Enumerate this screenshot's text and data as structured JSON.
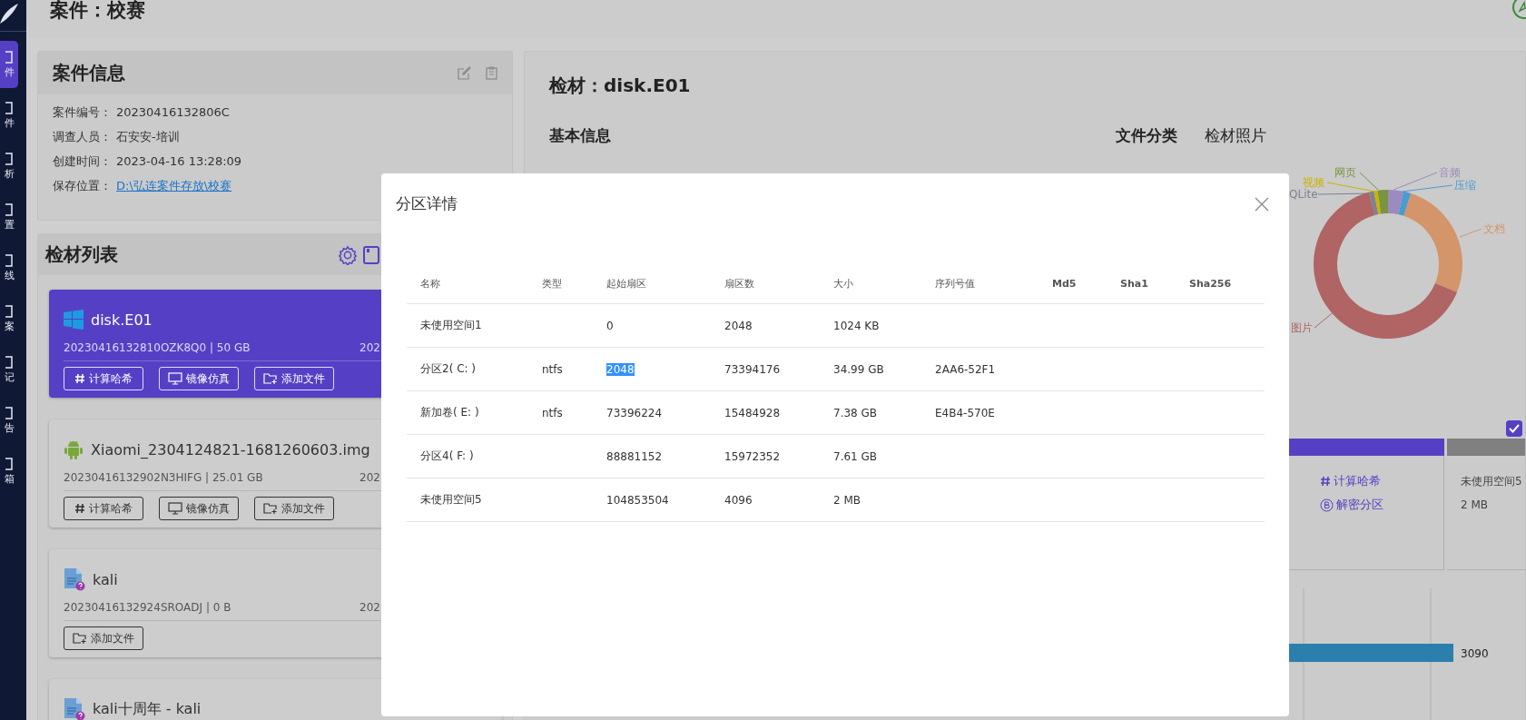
{
  "sidebar": {
    "items": [
      {
        "label": "件",
        "selected": true
      },
      {
        "label": "件",
        "selected": false
      },
      {
        "label": "析",
        "selected": false
      },
      {
        "label": "置",
        "selected": false
      },
      {
        "label": "线",
        "selected": false
      },
      {
        "label": "案",
        "selected": false
      },
      {
        "label": "记",
        "selected": false
      },
      {
        "label": "告",
        "selected": false
      },
      {
        "label": "箱",
        "selected": false
      }
    ]
  },
  "header": {
    "title": "案件：校赛"
  },
  "case_info": {
    "title": "案件信息",
    "fields": [
      {
        "label": "案件编号：",
        "value": "20230416132806C",
        "kind": "text"
      },
      {
        "label": "调查人员：",
        "value": "石安安-培训",
        "kind": "text"
      },
      {
        "label": "创建时间：",
        "value": "2023-04-16 13:28:09",
        "kind": "text"
      },
      {
        "label": "保存位置：",
        "value": "D:\\弘连案件存放\\校赛",
        "kind": "link"
      }
    ]
  },
  "evidence_list": {
    "title": "检材列表",
    "items": [
      {
        "name": "disk.E01",
        "kind": "windows",
        "selected": true,
        "meta": "20230416132810OZK8Q0 | 50 GB",
        "date": "202",
        "actions": [
          {
            "label": "计算哈希",
            "kind": "hash"
          },
          {
            "label": "镜像仿真",
            "kind": "emulate"
          },
          {
            "label": "添加文件",
            "kind": "add"
          }
        ]
      },
      {
        "name": "Xiaomi_2304124821-1681260603.img",
        "kind": "android",
        "selected": false,
        "meta": "20230416132902N3HIFG | 25.01 GB",
        "date": "202",
        "actions": [
          {
            "label": "计算哈希",
            "kind": "hash"
          },
          {
            "label": "镜像仿真",
            "kind": "emulate"
          },
          {
            "label": "添加文件",
            "kind": "add"
          }
        ]
      },
      {
        "name": "kali",
        "kind": "document",
        "selected": false,
        "meta": "20230416132924SROADJ | 0 B",
        "date": "202",
        "actions": [
          {
            "label": "添加文件",
            "kind": "add"
          }
        ]
      },
      {
        "name": "kali十周年 - kali",
        "kind": "document",
        "selected": false
      }
    ]
  },
  "evidence": {
    "title": "检材：disk.E01",
    "basic_info_title": "基本信息",
    "tabs": [
      {
        "label": "文件分类",
        "selected": true
      },
      {
        "label": "检材照片",
        "selected": false
      }
    ],
    "file_categories": [
      {
        "label": "QLite",
        "color": "#7b8294"
      },
      {
        "label": "视频",
        "color": "#c8b400"
      },
      {
        "label": "网页",
        "color": "#7a9440"
      },
      {
        "label": "音频",
        "color": "#9b8bbf"
      },
      {
        "label": "压缩",
        "color": "#4a9bd0"
      },
      {
        "label": "文档",
        "color": "#d4956a"
      },
      {
        "label": "图片",
        "color": "#b06464"
      }
    ],
    "show_partitions": {
      "checked": true
    },
    "partitions": [
      {
        "selected": true,
        "actions": [
          {
            "label": "计算哈希",
            "kind": "hash"
          },
          {
            "label": "解密分区",
            "kind": "decrypt"
          }
        ]
      },
      {
        "selected": false,
        "name": "未使用空间5",
        "size": "2 MB"
      }
    ],
    "bar_chart": {
      "value_label": "3090"
    }
  },
  "dialog": {
    "title": "分区详情",
    "columns": [
      "名称",
      "类型",
      "起始扇区",
      "扇区数",
      "大小",
      "序列号值",
      "Md5",
      "Sha1",
      "Sha256"
    ],
    "rows": [
      {
        "name": "未使用空间1",
        "start_sector": "0",
        "start_sector_highlighted": false,
        "sector_count": "2048",
        "size": "1024 KB"
      },
      {
        "name": "分区2( C: )",
        "type": "ntfs",
        "start_sector": "2048",
        "start_sector_highlighted": true,
        "sector_count": "73394176",
        "size": "34.99 GB",
        "serial": "2AA6-52F1"
      },
      {
        "name": "新加卷( E: )",
        "type": "ntfs",
        "start_sector": "73396224",
        "start_sector_highlighted": false,
        "sector_count": "15484928",
        "size": "7.38 GB",
        "serial": "E4B4-570E"
      },
      {
        "name": "分区4( F: )",
        "start_sector": "88881152",
        "start_sector_highlighted": false,
        "sector_count": "15972352",
        "size": "7.61 GB"
      },
      {
        "name": "未使用空间5",
        "start_sector": "104853504",
        "start_sector_highlighted": false,
        "sector_count": "4096",
        "size": "2 MB"
      }
    ]
  }
}
